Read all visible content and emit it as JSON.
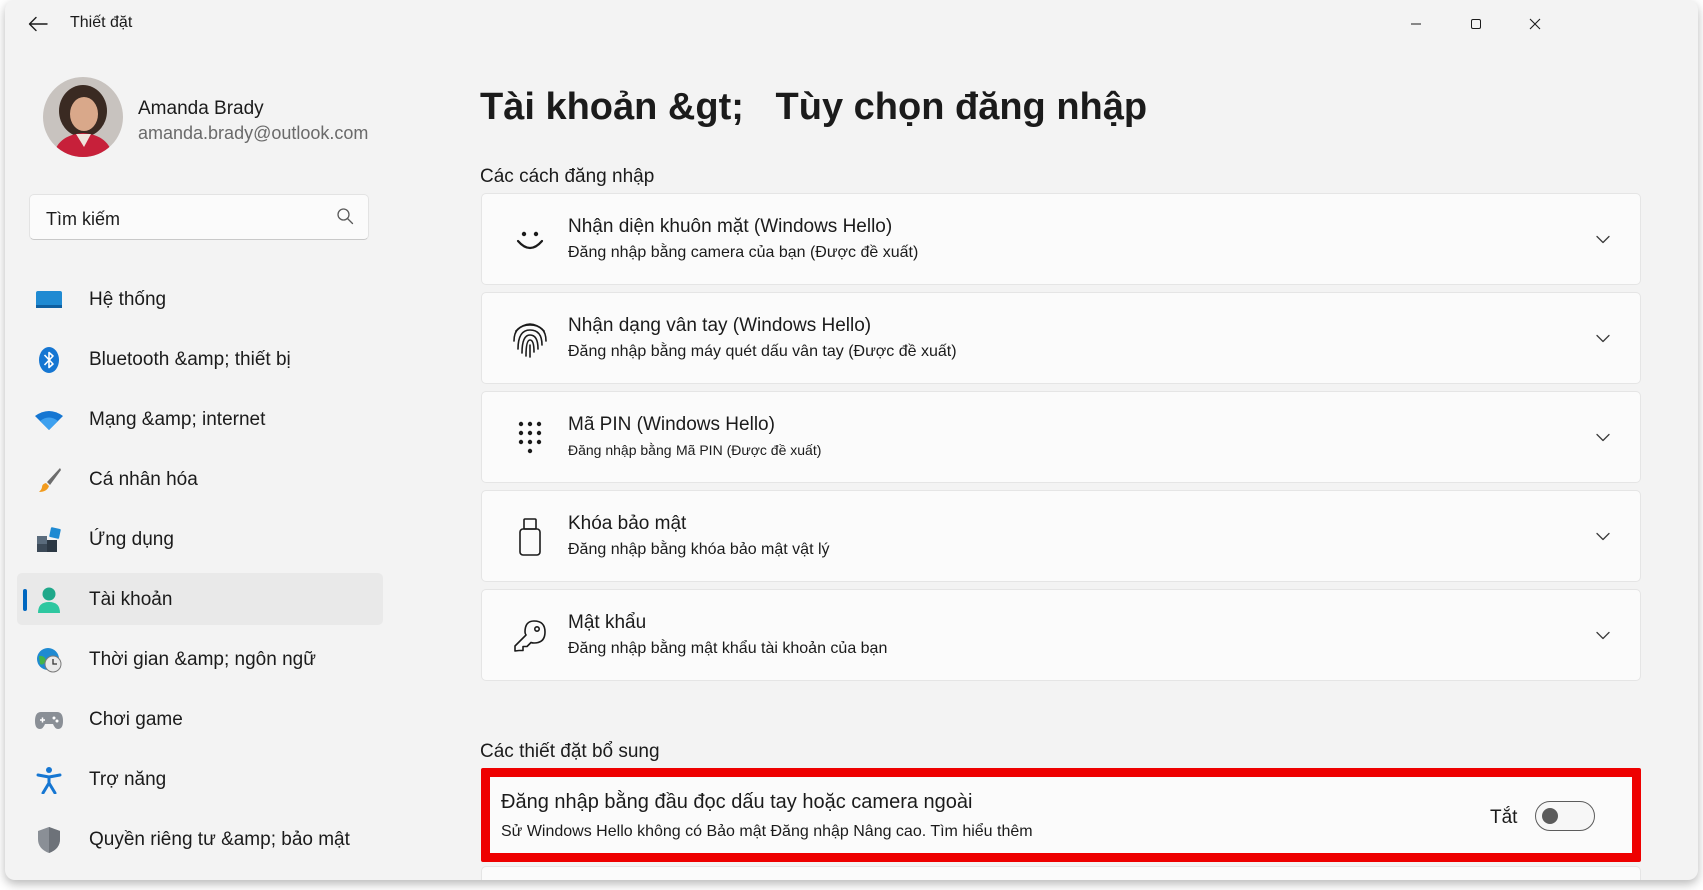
{
  "window": {
    "title": "Thiết đặt"
  },
  "user": {
    "name": "Amanda Brady",
    "email": "amanda.brady@outlook.com"
  },
  "search": {
    "placeholder": "Tìm kiếm"
  },
  "sidebar": {
    "items": [
      {
        "label": "Hệ thống",
        "icon": "system-icon"
      },
      {
        "label": "Bluetooth &amp; thiết bị",
        "icon": "bluetooth-icon"
      },
      {
        "label": "Mạng &amp; internet",
        "icon": "wifi-icon"
      },
      {
        "label": "Cá nhân hóa",
        "icon": "brush-icon"
      },
      {
        "label": "Ứng dụng",
        "icon": "apps-icon"
      },
      {
        "label": "Tài khoản",
        "icon": "account-icon",
        "active": true
      },
      {
        "label": "Thời gian &amp; ngôn ngữ",
        "icon": "time-language-icon"
      },
      {
        "label": "Chơi game",
        "icon": "gamepad-icon"
      },
      {
        "label": "Trợ năng",
        "icon": "accessibility-icon"
      },
      {
        "label": "Quyền riêng tư &amp; bảo mật",
        "icon": "shield-icon"
      }
    ]
  },
  "main": {
    "title": "Tài khoản &gt;   Tùy chọn đăng nhập",
    "sign_in_section": "Các cách đăng nhập",
    "methods": [
      {
        "title": "Nhận diện khuôn mặt (Windows Hello)",
        "subtitle": "Đăng nhập bằng camera của bạn (Được đề xuất)",
        "icon": "face-icon"
      },
      {
        "title": "Nhận dạng vân tay (Windows Hello)",
        "subtitle": "Đăng nhập bằng máy quét dấu vân tay (Được đề xuất)",
        "icon": "fingerprint-icon"
      },
      {
        "title": "Mã PIN (Windows Hello)",
        "subtitle_prefix": "Đăng nhập bằng",
        "subtitle": "Mã PIN (Được đề xuất)",
        "icon": "pin-keypad-icon"
      },
      {
        "title": "Khóa bảo mật",
        "subtitle": "Đăng nhập bằng khóa bảo mật vật lý",
        "icon": "usb-key-icon"
      },
      {
        "title": "Mật khẩu",
        "subtitle": "Đăng nhập bằng mật khẩu tài khoản của bạn",
        "icon": "key-icon"
      }
    ],
    "additional_section": "Các thiết đặt bổ sung",
    "external_reader": {
      "title": "Đăng nhập bằng đầu đọc dấu tay hoặc camera ngoài",
      "subtitle": "Sử Windows Hello không có Bảo mật Đăng nhập Nâng cao. Tìm hiểu thêm",
      "toggle_state_label": "Tắt",
      "toggle_on": false
    }
  },
  "colors": {
    "accent": "#0067c0",
    "highlight_border": "#ee0000",
    "background": "#f3f3f3",
    "card": "#fbfbfb"
  }
}
